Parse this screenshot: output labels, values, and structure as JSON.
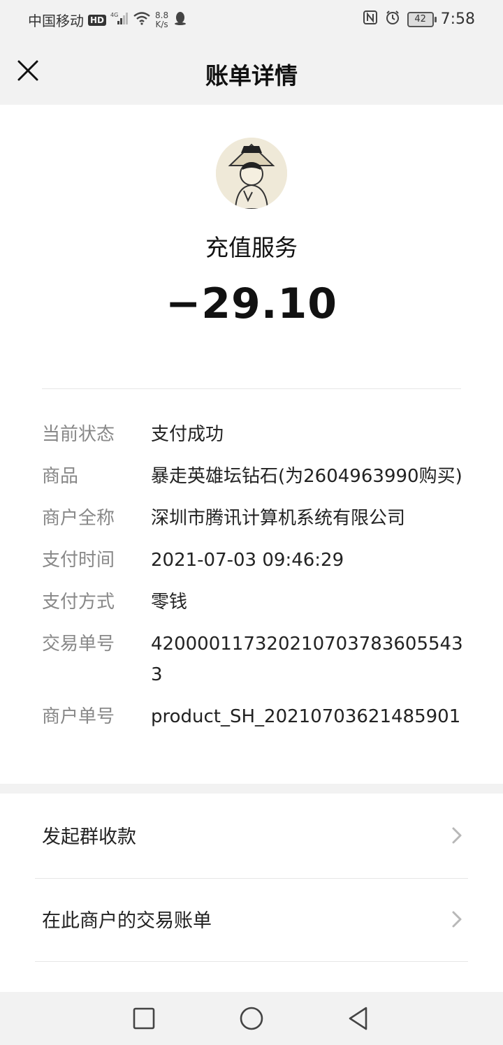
{
  "status_bar": {
    "carrier": "中国移动",
    "hd": "HD",
    "network": "4G",
    "speed_value": "8.8",
    "speed_unit": "K/s",
    "battery": "42",
    "time": "7:58"
  },
  "header": {
    "title": "账单详情"
  },
  "summary": {
    "merchant": "充值服务",
    "amount": "−29.10"
  },
  "details": [
    {
      "label": "当前状态",
      "value": "支付成功"
    },
    {
      "label": "商品",
      "value": "暴走英雄坛钻石(为2604963990购买)"
    },
    {
      "label": "商户全称",
      "value": "深圳市腾讯计算机系统有限公司"
    },
    {
      "label": "支付时间",
      "value": "2021-07-03 09:46:29"
    },
    {
      "label": "支付方式",
      "value": "零钱"
    },
    {
      "label": "交易单号",
      "value": "4200001173202107037836055433"
    },
    {
      "label": "商户单号",
      "value": "product_SH_20210703621485901"
    }
  ],
  "actions": [
    {
      "label": "发起群收款"
    },
    {
      "label": "在此商户的交易账单"
    }
  ]
}
